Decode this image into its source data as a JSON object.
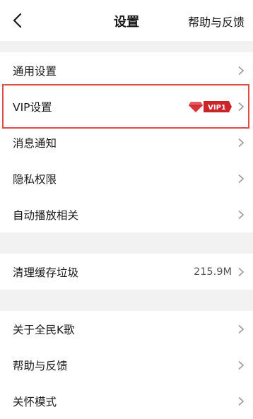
{
  "header": {
    "title": "设置",
    "help_link": "帮助与反馈",
    "back_icon": "chevron-left-icon"
  },
  "groups": [
    {
      "items": [
        {
          "label": "通用设置"
        },
        {
          "label": "VIP设置",
          "badge": "VIP1"
        },
        {
          "label": "消息通知"
        },
        {
          "label": "隐私权限"
        },
        {
          "label": "自动播放相关"
        }
      ]
    },
    {
      "items": [
        {
          "label": "清理缓存垃圾",
          "value": "215.9M"
        }
      ]
    },
    {
      "items": [
        {
          "label": "关于全民K歌"
        },
        {
          "label": "帮助与反馈"
        },
        {
          "label": "关怀模式"
        }
      ]
    }
  ],
  "colors": {
    "highlight_border": "#d9504a",
    "vip_badge": "#c9252b",
    "background": "#f2f2f2"
  }
}
